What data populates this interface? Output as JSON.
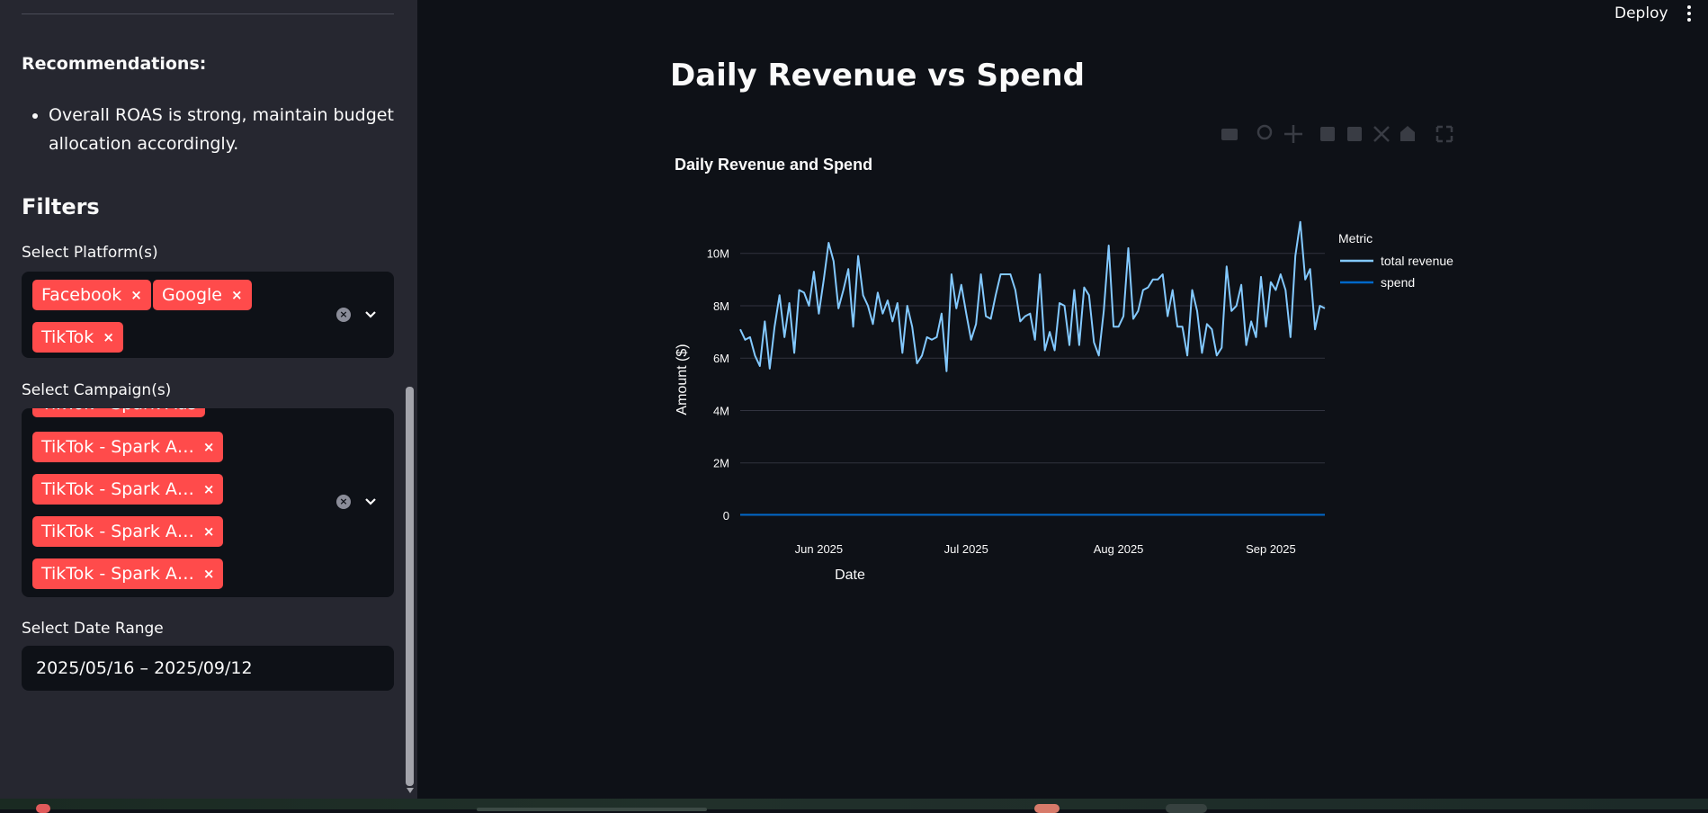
{
  "app": {
    "deploy_label": "Deploy"
  },
  "sidebar": {
    "recommendations_title": "Recommendations:",
    "recommendations": [
      "Overall ROAS is strong, maintain budget allocation accordingly."
    ],
    "filters_title": "Filters",
    "platform_label": "Select Platform(s)",
    "platforms": [
      "Facebook",
      "Google",
      "TikTok"
    ],
    "campaign_label": "Select Campaign(s)",
    "campaigns_partial": "TikTok - Spark Ads",
    "campaigns": [
      "TikTok - Spark A…",
      "TikTok - Spark A…",
      "TikTok - Spark A…",
      "TikTok - Spark A…"
    ],
    "date_label": "Select Date Range",
    "date_value": "2025/05/16 – 2025/09/12",
    "remove_glyph": "×",
    "clear_glyph": "×"
  },
  "main": {
    "title": "Daily Revenue vs Spend"
  },
  "colors": {
    "accent": "#ff4b4b",
    "revenue": "#83c9ff",
    "spend": "#0068c9",
    "bg": "#0e1117",
    "sidebar": "#262730"
  },
  "chart_data": {
    "type": "line",
    "title": "Daily Revenue and Spend",
    "xlabel": "Date",
    "ylabel": "Amount ($)",
    "x_start": "2025-05-16",
    "x_end": "2025-09-12",
    "x_ticks": [
      "Jun 2025",
      "Jul 2025",
      "Aug 2025",
      "Sep 2025"
    ],
    "y_ticks": [
      "0",
      "2M",
      "4M",
      "6M",
      "8M",
      "10M"
    ],
    "ylim": [
      0,
      11500000
    ],
    "grid": true,
    "legend_title": "Metric",
    "legend_position": "right",
    "series": [
      {
        "name": "total revenue",
        "values": [
          7.1,
          6.7,
          6.8,
          6.1,
          5.7,
          7.4,
          5.6,
          7.2,
          8.4,
          6.8,
          8.1,
          6.2,
          8.6,
          8.5,
          8.0,
          9.3,
          7.7,
          9.0,
          10.4,
          9.7,
          7.9,
          8.6,
          9.4,
          7.2,
          9.9,
          8.4,
          8.0,
          7.3,
          8.5,
          7.7,
          8.2,
          7.4,
          8.1,
          6.2,
          8.0,
          7.2,
          5.8,
          6.1,
          6.8,
          6.7,
          6.8,
          7.7,
          5.5,
          9.2,
          7.9,
          8.8,
          7.7,
          6.7,
          7.3,
          9.2,
          7.6,
          7.5,
          8.4,
          9.2,
          9.2,
          9.2,
          8.6,
          7.4,
          7.6,
          7.7,
          6.7,
          9.2,
          6.3,
          7.0,
          6.3,
          8.1,
          8.0,
          6.5,
          8.6,
          6.5,
          8.7,
          8.4,
          6.6,
          6.1,
          7.8,
          10.3,
          7.2,
          7.2,
          7.6,
          10.2,
          7.5,
          7.8,
          8.6,
          8.7,
          9.0,
          9.0,
          9.2,
          7.6,
          8.6,
          7.2,
          7.2,
          6.1,
          8.6,
          7.8,
          6.2,
          7.3,
          7.1,
          6.1,
          6.4,
          9.5,
          7.8,
          8.0,
          8.8,
          6.5,
          7.4,
          6.8,
          9.1,
          7.2,
          8.9,
          8.6,
          9.2,
          8.6,
          6.8,
          9.9,
          11.2,
          9.0,
          9.4,
          7.1,
          8.0,
          7.9
        ]
      },
      {
        "name": "spend",
        "values": [
          0.02,
          0.02,
          0.02,
          0.02,
          0.02,
          0.02,
          0.02,
          0.02,
          0.02,
          0.02,
          0.02,
          0.02,
          0.02,
          0.02,
          0.02,
          0.02,
          0.02,
          0.02,
          0.02,
          0.02,
          0.02,
          0.02,
          0.02,
          0.02,
          0.02,
          0.02,
          0.02,
          0.02,
          0.02,
          0.02,
          0.02,
          0.02,
          0.02,
          0.02,
          0.02,
          0.02,
          0.02,
          0.02,
          0.02,
          0.02,
          0.02,
          0.02,
          0.02,
          0.02,
          0.02,
          0.02,
          0.02,
          0.02,
          0.02,
          0.02,
          0.02,
          0.02,
          0.02,
          0.02,
          0.02,
          0.02,
          0.02,
          0.02,
          0.02,
          0.02,
          0.02,
          0.02,
          0.02,
          0.02,
          0.02,
          0.02,
          0.02,
          0.02,
          0.02,
          0.02,
          0.02,
          0.02,
          0.02,
          0.02,
          0.02,
          0.02,
          0.02,
          0.02,
          0.02,
          0.02,
          0.02,
          0.02,
          0.02,
          0.02,
          0.02,
          0.02,
          0.02,
          0.02,
          0.02,
          0.02,
          0.02,
          0.02,
          0.02,
          0.02,
          0.02,
          0.02,
          0.02,
          0.02,
          0.02,
          0.02,
          0.02,
          0.02,
          0.02,
          0.02,
          0.02,
          0.02,
          0.02,
          0.02,
          0.02,
          0.02,
          0.02,
          0.02,
          0.02,
          0.02,
          0.02,
          0.02,
          0.02,
          0.02,
          0.02,
          0.02
        ]
      }
    ],
    "value_unit": "M"
  }
}
